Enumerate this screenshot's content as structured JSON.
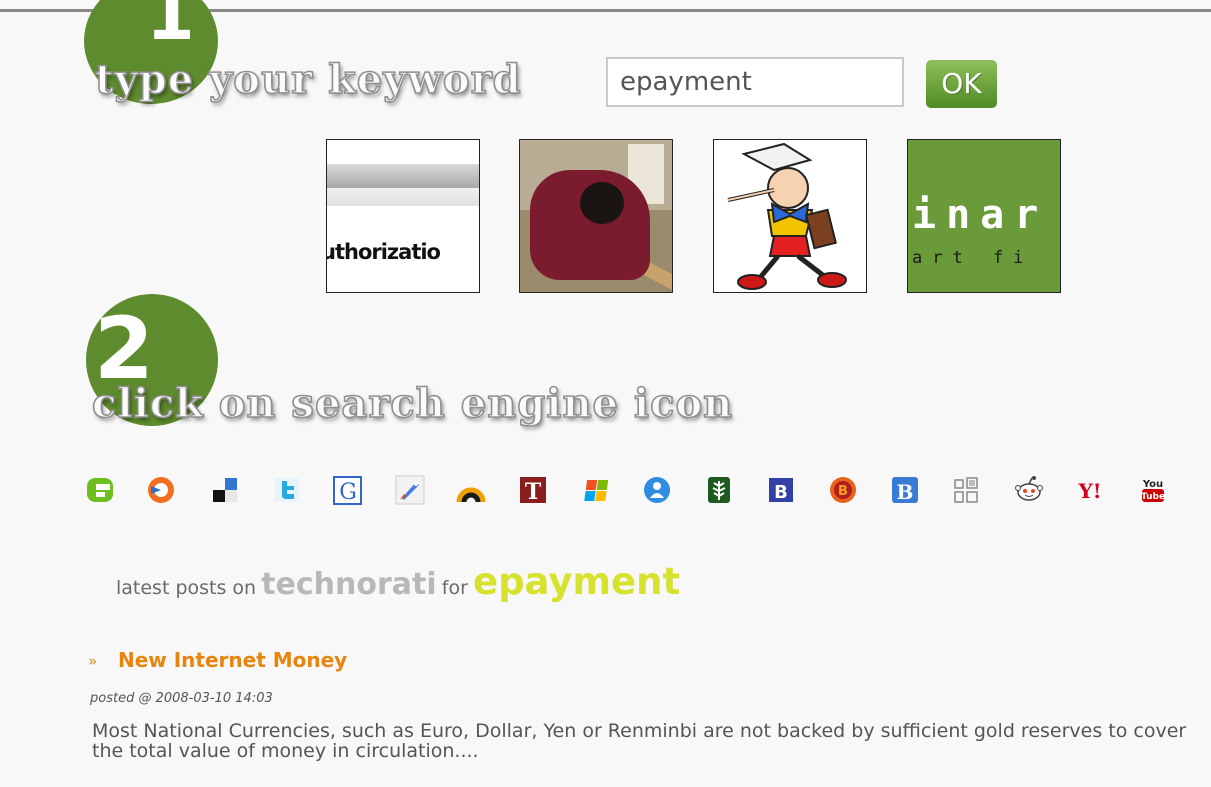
{
  "step1": {
    "number": "1",
    "heading": "type your keyword",
    "search_value": "epayment",
    "ok_label": "OK"
  },
  "thumbnails": [
    {
      "name": "authorization-thumb",
      "text": "uthorizatio"
    },
    {
      "name": "sleeping-person-thumb"
    },
    {
      "name": "pinocchio-thumb"
    },
    {
      "name": "green-banner-thumb",
      "big_text": "inar",
      "small_text": "art fi"
    }
  ],
  "step2": {
    "number": "2",
    "heading": "click on search engine icon"
  },
  "engines": [
    {
      "icon": "technorati-icon",
      "color": "#6cbf1f"
    },
    {
      "icon": "orange-circle-icon",
      "color": "#f36f1f"
    },
    {
      "icon": "delicious-icon",
      "color": "#3274d1"
    },
    {
      "icon": "twitter-icon",
      "color": "#2aa9e0"
    },
    {
      "icon": "google-icon",
      "color": "#3266cc"
    },
    {
      "icon": "rocket-icon",
      "color": "#4a7ad8"
    },
    {
      "icon": "rainbow-arch-icon",
      "color": "#f0a000"
    },
    {
      "icon": "t-block-icon",
      "color": "#8a1e1e"
    },
    {
      "icon": "windows-icon",
      "color": "#f25022"
    },
    {
      "icon": "blue-circle-icon",
      "color": "#2e8de0"
    },
    {
      "icon": "leaf-icon",
      "color": "#2a6a2a"
    },
    {
      "icon": "b-square-icon",
      "color": "#3341a6"
    },
    {
      "icon": "bebo-icon",
      "color": "#e8641e"
    },
    {
      "icon": "blogger-b-icon",
      "color": "#3a7bd5"
    },
    {
      "icon": "grid-icon",
      "color": "#999999"
    },
    {
      "icon": "reddit-icon",
      "color": "#555555"
    },
    {
      "icon": "yahoo-icon",
      "color": "#d0021b"
    },
    {
      "icon": "youtube-icon",
      "color": "#cc0000"
    }
  ],
  "latest": {
    "prefix": "latest posts on",
    "site": "technorati",
    "connector": "for",
    "keyword": "epayment"
  },
  "post": {
    "bullet": "»",
    "title": "New Internet Money",
    "date": "posted @ 2008-03-10 14:03",
    "excerpt": "Most National Currencies, such as Euro, Dollar, Yen or Renminbi are not backed by sufficient gold reserves to cover the total value of money in circulation...."
  }
}
